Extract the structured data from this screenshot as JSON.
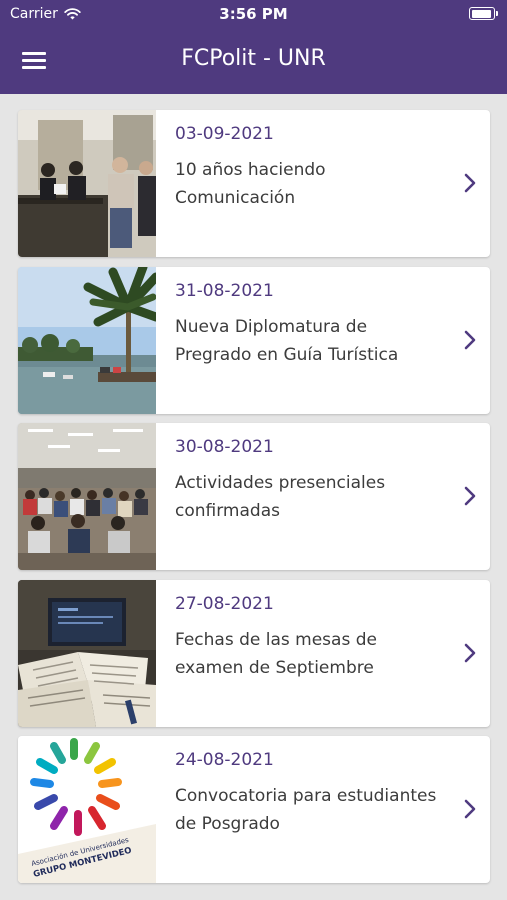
{
  "status": {
    "carrier": "Carrier",
    "time": "3:56 PM"
  },
  "nav": {
    "title": "FCPolit - UNR"
  },
  "news": [
    {
      "date": "03-09-2021",
      "title": "10 años haciendo Comunicación"
    },
    {
      "date": "31-08-2021",
      "title": "Nueva Diplomatura de Pregrado en Guía Turística"
    },
    {
      "date": "30-08-2021",
      "title": "Actividades presenciales confirmadas"
    },
    {
      "date": "27-08-2021",
      "title": "Fechas de las mesas de examen de Septiembre"
    },
    {
      "date": "24-08-2021",
      "title": "Convocatoria para estudiantes de Posgrado"
    }
  ],
  "logo_text": "Asociación de Universidades GRUPO MONTEVIDEO",
  "colors": {
    "header": "#4f3a7f",
    "background": "#e5e5e5",
    "card": "#ffffff",
    "date": "#4f3a7f",
    "chevron": "#4f3a7f"
  },
  "icons": {
    "menu": "hamburger-menu-icon",
    "chevron": "chevron-right-icon",
    "wifi": "wifi-icon",
    "battery": "battery-icon"
  }
}
